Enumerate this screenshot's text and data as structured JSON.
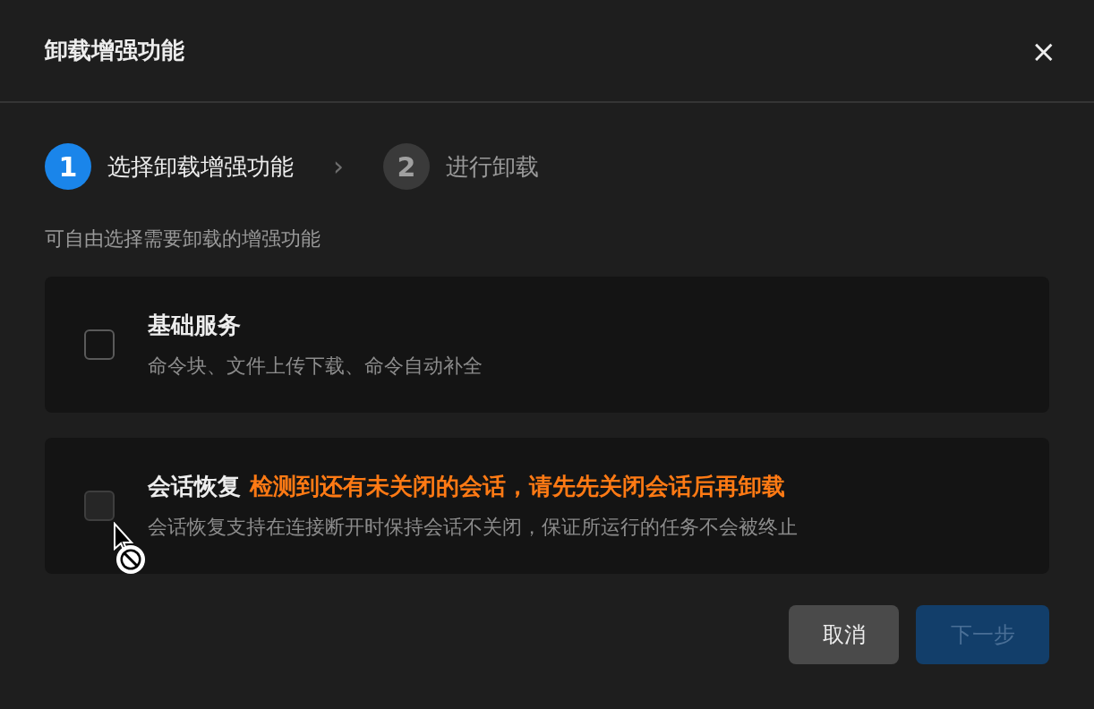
{
  "dialog": {
    "title": "卸载增强功能",
    "close": "×"
  },
  "steps": [
    {
      "number": "1",
      "label": "选择卸载增强功能",
      "selected": true
    },
    {
      "number": "2",
      "label": "进行卸载",
      "selected": false
    }
  ],
  "step_separator": "›",
  "subtitle": "可自由选择需要卸载的增强功能",
  "options": [
    {
      "title": "基础服务",
      "description": "命令块、文件上传下载、命令自动补全",
      "checked": false,
      "disabled": false
    },
    {
      "title": "会话恢复",
      "warning": "检测到还有未关闭的会话，请先先关闭会话后再卸载",
      "description": "会话恢复支持在连接断开时保持会话不关闭，保证所运行的任务不会被终止",
      "checked": false,
      "disabled": true
    }
  ],
  "buttons": [
    {
      "label": "取消",
      "kind": "secondary",
      "disabled": false
    },
    {
      "label": "下一步",
      "kind": "primary",
      "disabled": true
    }
  ]
}
